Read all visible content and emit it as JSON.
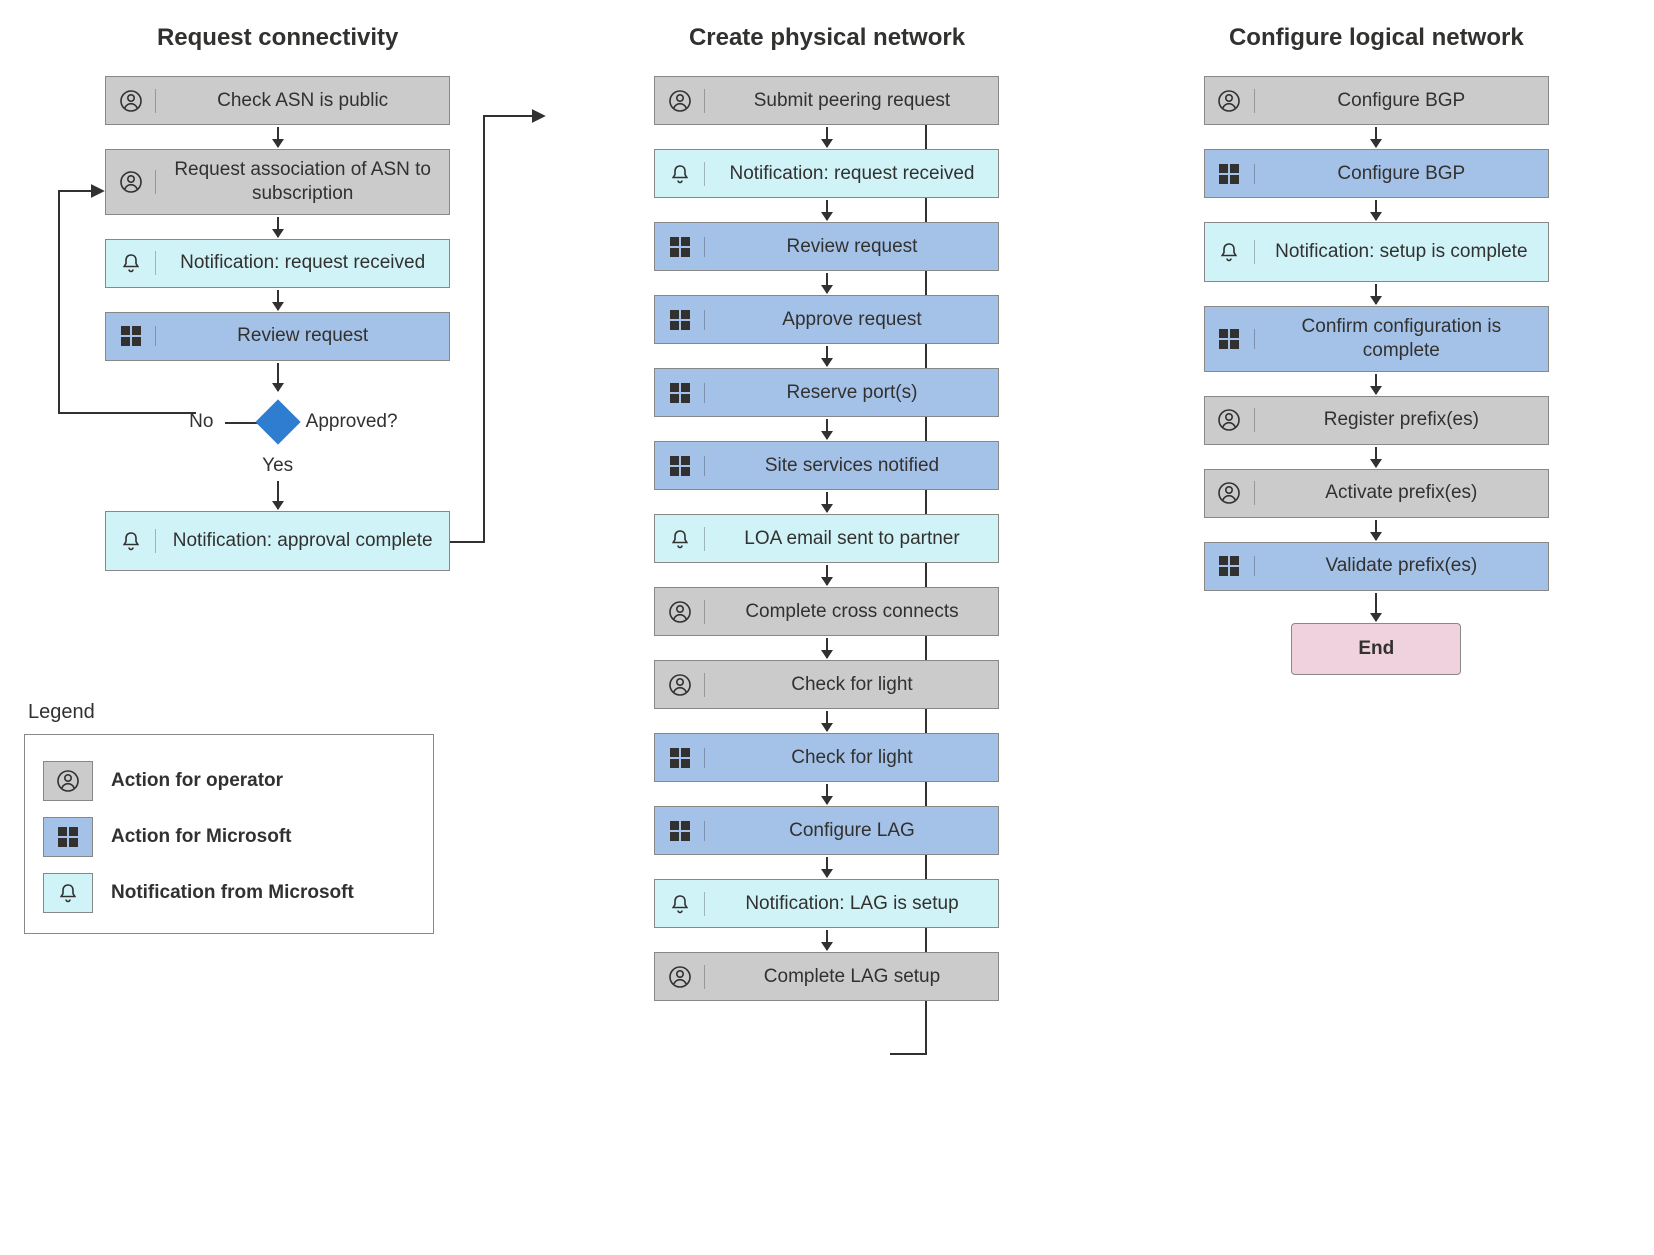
{
  "columns": {
    "c1": {
      "title": "Request connectivity"
    },
    "c2": {
      "title": "Create physical network"
    },
    "c3": {
      "title": "Configure logical network"
    }
  },
  "nodes": {
    "c1n1": "Check ASN is public",
    "c1n2": "Request association of ASN to subscription",
    "c1n3": "Notification: request received",
    "c1n4": "Review request",
    "c1d_no": "No",
    "c1d_q": "Approved?",
    "c1d_yes": "Yes",
    "c1n5": "Notification: approval complete",
    "c2n1": "Submit peering request",
    "c2n2": "Notification: request received",
    "c2n3": "Review request",
    "c2n4": "Approve request",
    "c2n5": "Reserve port(s)",
    "c2n6": "Site services notified",
    "c2n7": "LOA email sent to partner",
    "c2n8": "Complete cross connects",
    "c2n9": "Check for light",
    "c2n10": "Check for light",
    "c2n11": "Configure LAG",
    "c2n12": "Notification: LAG is setup",
    "c2n13": "Complete LAG setup",
    "c3n1": "Configure BGP",
    "c3n2": "Configure BGP",
    "c3n3": "Notification: setup is complete",
    "c3n4": "Confirm configuration is complete",
    "c3n5": "Register prefix(es)",
    "c3n6": "Activate prefix(es)",
    "c3n7": "Validate prefix(es)",
    "c3end": "End"
  },
  "legend": {
    "title": "Legend",
    "operator": "Action for operator",
    "microsoft": "Action for Microsoft",
    "notify": "Notification from Microsoft"
  }
}
